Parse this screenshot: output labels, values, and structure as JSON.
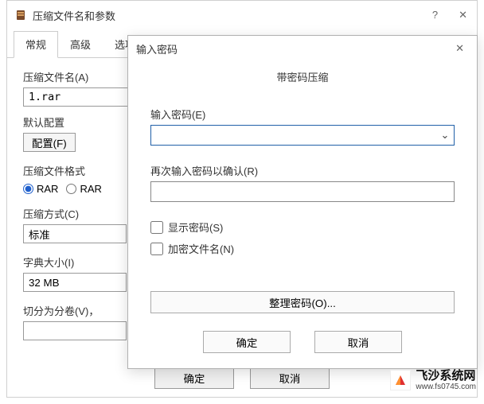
{
  "main": {
    "title": "压缩文件名和参数",
    "tabs": [
      "常规",
      "高级",
      "选项"
    ],
    "activeTab": 0,
    "archiveNameLabel": "压缩文件名(A)",
    "archiveName": "1.rar",
    "defaultProfileLabel": "默认配置",
    "configBtn": "配置(F)",
    "formatLabel": "压缩文件格式",
    "formatOptions": {
      "rar": "RAR",
      "rar4": "RAR"
    },
    "methodLabel": "压缩方式(C)",
    "methodValue": "标准",
    "dictLabel": "字典大小(I)",
    "dictValue": "32 MB",
    "splitLabel": "切分为分卷(V)，",
    "okBtn": "确定",
    "cancelBtn": "取消"
  },
  "pwd": {
    "title": "输入密码",
    "heading": "带密码压缩",
    "enterLabel": "输入密码(E)",
    "reenterLabel": "再次输入密码以确认(R)",
    "showPwd": "显示密码(S)",
    "encryptNames": "加密文件名(N)",
    "organizeBtn": "整理密码(O)...",
    "okBtn": "确定",
    "cancelBtn": "取消"
  },
  "watermark": {
    "name": "飞沙系统网",
    "url": "www.fs0745.com"
  }
}
